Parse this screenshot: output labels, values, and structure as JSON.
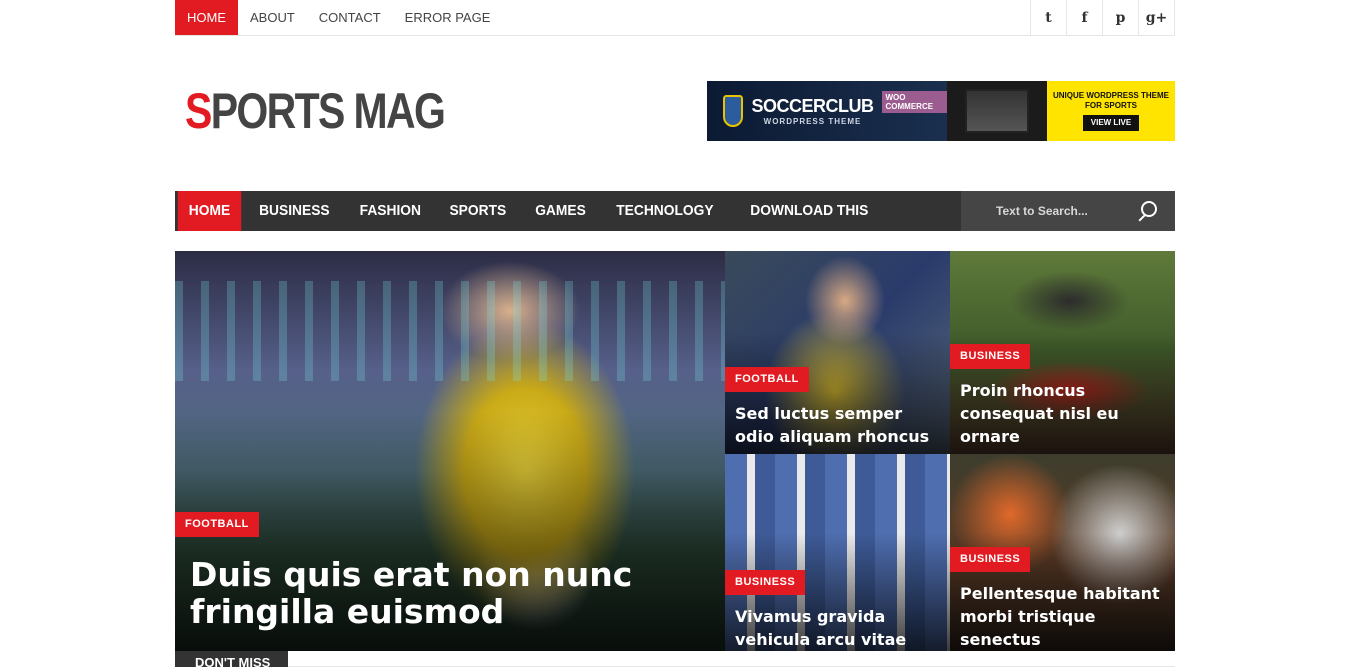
{
  "topbar": {
    "links": [
      "HOME",
      "ABOUT",
      "CONTACT",
      "ERROR PAGE"
    ],
    "social": [
      {
        "icon": "twitter-icon",
        "glyph": "t"
      },
      {
        "icon": "facebook-icon",
        "glyph": "f"
      },
      {
        "icon": "pinterest-icon",
        "glyph": "p"
      },
      {
        "icon": "google-plus-icon",
        "glyph": "g+"
      }
    ]
  },
  "header": {
    "logo_first": "S",
    "logo_rest": "PORTS MAG",
    "banner": {
      "brand": "SOCCERCLUB",
      "brand_sub": "WORDPRESS THEME",
      "woo": "WOO COMMERCE",
      "tagline": "UNIQUE WORDPRESS THEME FOR SPORTS",
      "cta": "VIEW LIVE"
    }
  },
  "nav": {
    "items": [
      "HOME",
      "BUSINESS",
      "FASHION",
      "SPORTS",
      "GAMES",
      "TECHNOLOGY",
      "DOWNLOAD THIS TEMPLATE"
    ],
    "search_placeholder": "Text to Search..."
  },
  "featured": {
    "main": {
      "category": "FOOTBALL",
      "title": "Duis quis erat non nunc fringilla euismod"
    },
    "posts": [
      {
        "category": "FOOTBALL",
        "title": "Sed luctus semper odio aliquam rhoncus"
      },
      {
        "category": "BUSINESS",
        "title": "Proin rhoncus consequat nisl eu ornare"
      },
      {
        "category": "BUSINESS",
        "title": "Vivamus gravida vehicula arcu vitae"
      },
      {
        "category": "BUSINESS",
        "title": "Pellentesque habitant morbi tristique senectus"
      }
    ]
  },
  "section": {
    "dont_miss": "DON'T MISS"
  },
  "colors": {
    "accent": "#e21b22",
    "nav_bg": "#333333",
    "search_bg": "#454545"
  }
}
